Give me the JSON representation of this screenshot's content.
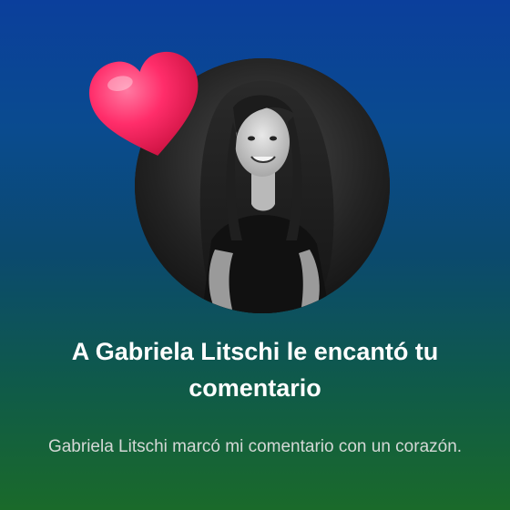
{
  "notification": {
    "title": "A Gabriela Litschi le encantó tu comentario",
    "message": "Gabriela Litschi marcó mi comentario con un corazón.",
    "reaction_icon": "heart-icon",
    "colors": {
      "heart": "#ff2d6a",
      "background_top": "#0b3f9c",
      "background_bottom": "#1a6a2a",
      "text_primary": "#ffffff",
      "text_secondary": "#d4d8d6"
    }
  }
}
